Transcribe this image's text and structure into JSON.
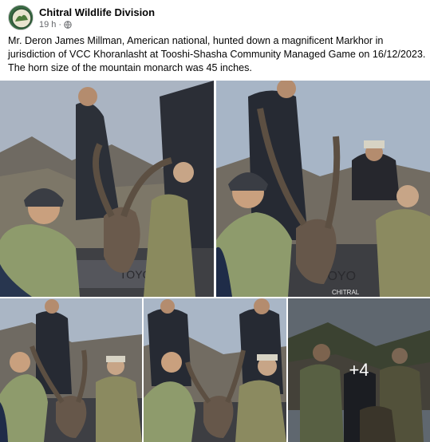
{
  "post": {
    "author": "Chitral Wildlife Division",
    "time": "19 h",
    "separator": "·",
    "privacy_icon": "globe-icon",
    "text": "Mr. Deron James Millman, American national, hunted down a magnificent Markhor in jurisdiction of VCC Khoranlasht at Tooshi-Shasha Community Managed Game on 16/12/2023. The horn size of the mountain monarch was 45 inches."
  },
  "photos": {
    "more_label": "+4",
    "items": [
      {
        "description_icon": "photo"
      },
      {
        "description_icon": "photo"
      },
      {
        "description_icon": "photo"
      },
      {
        "description_icon": "photo"
      },
      {
        "description_icon": "photo"
      }
    ]
  },
  "colors": {
    "author_text": "#050505",
    "meta_text": "#65676b",
    "sky": "#a9b6c6",
    "jacket_green": "#8c9a6a",
    "vehicle": "#4a4a4e"
  }
}
